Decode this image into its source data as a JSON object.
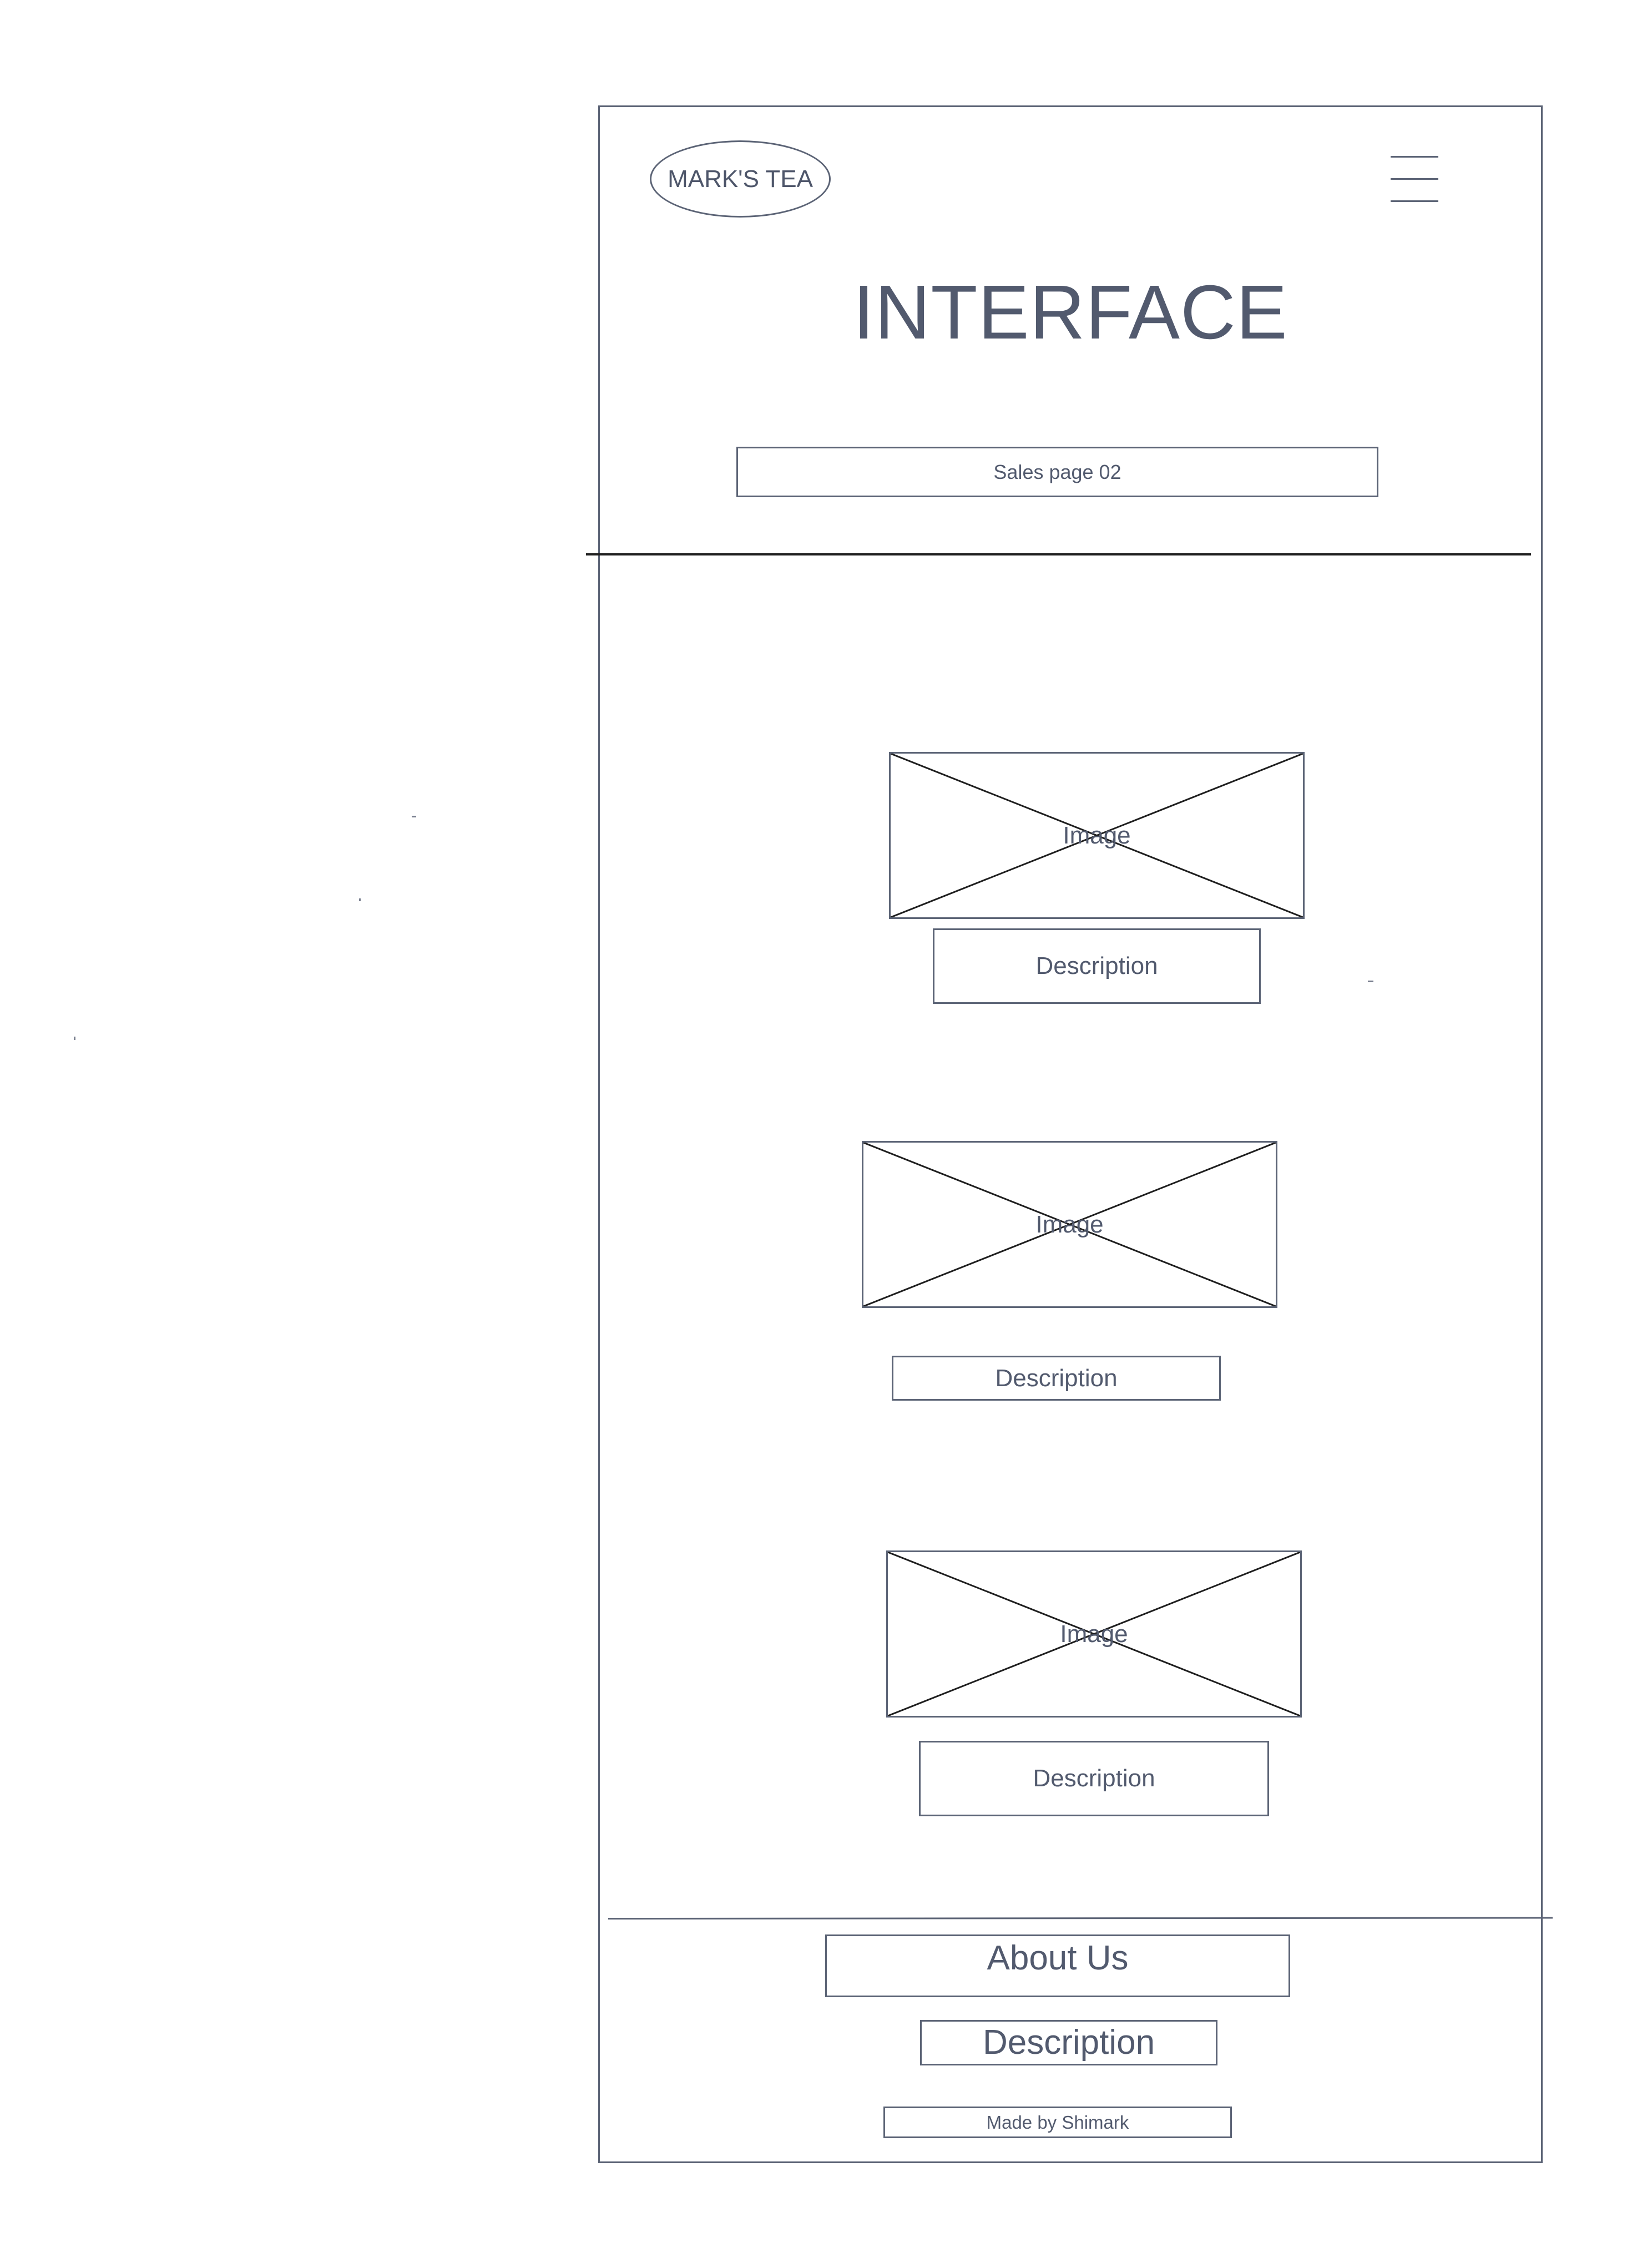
{
  "header": {
    "logo_text": "MARK'S TEA",
    "menu_icon": "hamburger-menu-icon",
    "title": "INTERFACE",
    "subtitle": "Sales page 02"
  },
  "products": [
    {
      "image_label": "Image",
      "description": "Description"
    },
    {
      "image_label": "Image",
      "description": "Description"
    },
    {
      "image_label": "Image",
      "description": "Description"
    }
  ],
  "footer": {
    "about_label": "About Us",
    "description": "Description",
    "credit": "Made by Shimark"
  },
  "colors": {
    "stroke": "#5c6476",
    "text": "#525a6e",
    "divider": "#1f1f1f",
    "background": "#ffffff"
  }
}
